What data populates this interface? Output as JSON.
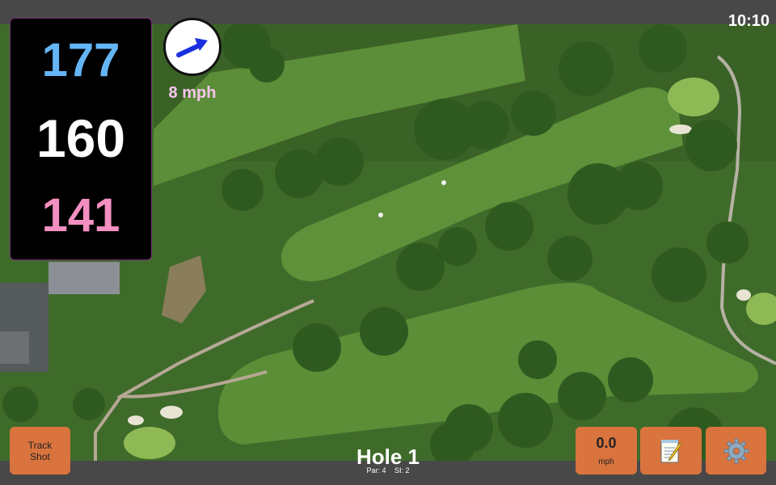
{
  "status": {
    "time": "10:10"
  },
  "distances": {
    "back": "177",
    "middle": "160",
    "front": "141"
  },
  "wind": {
    "speed": "8 mph",
    "arrow_icon": "wind-direction-arrow-icon",
    "arrow_color": "#1a2fe0"
  },
  "buttons": {
    "track_shot_line1": "Track",
    "track_shot_line2": "Shot",
    "speed_value": "0.0",
    "speed_unit": "mph",
    "notes_icon": "notepad-icon",
    "settings_icon": "gear-icon"
  },
  "hole": {
    "title": "Hole 1",
    "par": "Par: 4",
    "si": "SI: 2"
  },
  "colors": {
    "button": "#d9743e",
    "back_distance": "#64b5f6",
    "middle_distance": "#ffffff",
    "front_distance": "#f48fc1",
    "wind_text": "#f8c6ef"
  }
}
